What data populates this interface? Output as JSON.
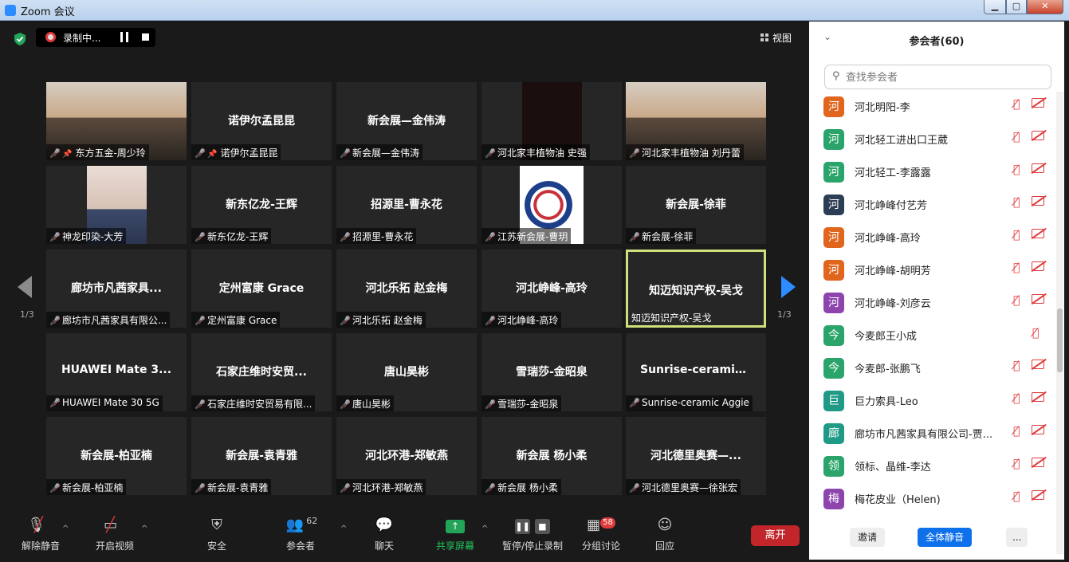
{
  "window": {
    "title": "Zoom 会议",
    "min": "▁",
    "max": "▢",
    "close": "✕"
  },
  "top": {
    "rec_label": "录制中...",
    "view_label": "视图"
  },
  "pager": {
    "left": "1/3",
    "right": "1/3"
  },
  "tiles": [
    {
      "big": "",
      "label": "东方五金-周少玲"
    },
    {
      "big": "诺伊尔孟昆昆",
      "label": "诺伊尔孟昆昆"
    },
    {
      "big": "新会展—金伟涛",
      "label": "新会展—金伟涛"
    },
    {
      "big": "",
      "label": "河北家丰植物油 史强"
    },
    {
      "big": "",
      "label": "河北家丰植物油 刘丹蕾"
    },
    {
      "big": "",
      "label": "神龙印染-大芳"
    },
    {
      "big": "新东亿龙-王辉",
      "label": "新东亿龙-王辉"
    },
    {
      "big": "招源里-曹永花",
      "label": "招源里-曹永花"
    },
    {
      "big": "",
      "label": "江苏新会展-曹玥"
    },
    {
      "big": "新会展-徐菲",
      "label": "新会展-徐菲"
    },
    {
      "big": "廊坊市凡茜家具...",
      "label": "廊坊市凡茜家具有限公..."
    },
    {
      "big": "定州富康 Grace",
      "label": "定州富康 Grace"
    },
    {
      "big": "河北乐拓 赵金梅",
      "label": "河北乐拓 赵金梅"
    },
    {
      "big": "河北峥峰-高玲",
      "label": "河北峥峰-高玲"
    },
    {
      "big": "知迈知识产权-吴戈",
      "label": "知迈知识产权-吴戈"
    },
    {
      "big": "HUAWEI Mate 3...",
      "label": "HUAWEI Mate 30 5G"
    },
    {
      "big": "石家庄维时安贸...",
      "label": "石家庄维时安贸易有限..."
    },
    {
      "big": "唐山昊彬",
      "label": "唐山昊彬"
    },
    {
      "big": "雪瑞莎-金昭泉",
      "label": "雪瑞莎-金昭泉"
    },
    {
      "big": "Sunrise-ceramic...",
      "label": "Sunrise-ceramic Aggie"
    },
    {
      "big": "新会展-柏亚楠",
      "label": "新会展-柏亚楠"
    },
    {
      "big": "新会展-袁青雅",
      "label": "新会展-袁青雅"
    },
    {
      "big": "河北环港-郑敏燕",
      "label": "河北环港-郑敏燕"
    },
    {
      "big": "新会展 杨小柔",
      "label": "新会展 杨小柔"
    },
    {
      "big": "河北德里奥赛—...",
      "label": "河北德里奥赛—徐张宏"
    }
  ],
  "toolbar": {
    "unmute": "解除静音",
    "video": "开启视频",
    "security": "安全",
    "participants": "参会者",
    "participants_count": "62",
    "chat": "聊天",
    "share": "共享屏幕",
    "record": "暂停/停止录制",
    "breakout": "分组讨论",
    "breakout_badge": "58",
    "reactions": "回应",
    "leave": "离开"
  },
  "panel": {
    "title": "参会者(60)",
    "search_placeholder": "查找参会者",
    "participants": [
      {
        "avatar": "河",
        "name": "河北明阳-李",
        "color": "#e0651d",
        "cam": true
      },
      {
        "avatar": "河",
        "name": "河北轻工进出口王葳",
        "color": "#2aa46a",
        "cam": true
      },
      {
        "avatar": "河",
        "name": "河北轻工-李露露",
        "color": "#2aa46a",
        "cam": true
      },
      {
        "avatar": "河",
        "name": "河北峥峰付艺芳",
        "color": "#2c3e55",
        "cam": true
      },
      {
        "avatar": "河",
        "name": "河北峥峰-高玲",
        "color": "#e0651d",
        "cam": true
      },
      {
        "avatar": "河",
        "name": "河北峥峰-胡明芳",
        "color": "#e0651d",
        "cam": true
      },
      {
        "avatar": "河",
        "name": "河北峥峰-刘彦云",
        "color": "#8e44ad",
        "cam": true
      },
      {
        "avatar": "今",
        "name": "今麦郎王小成",
        "color": "#2aa46a",
        "cam": false
      },
      {
        "avatar": "今",
        "name": "今麦郎-张鹏飞",
        "color": "#2aa46a",
        "cam": true
      },
      {
        "avatar": "巨",
        "name": "巨力索具-Leo",
        "color": "#1f9a86",
        "cam": true
      },
      {
        "avatar": "廊",
        "name": "廊坊市凡茜家具有限公司-贾...",
        "color": "#1f9a86",
        "cam": true
      },
      {
        "avatar": "领",
        "name": "领标、晶维-李达",
        "color": "#2aa46a",
        "cam": true
      },
      {
        "avatar": "梅",
        "name": "梅花皮业（Helen)",
        "color": "#8e44ad",
        "cam": true
      }
    ],
    "invite": "邀请",
    "mute_all": "全体静音",
    "more": "..."
  }
}
